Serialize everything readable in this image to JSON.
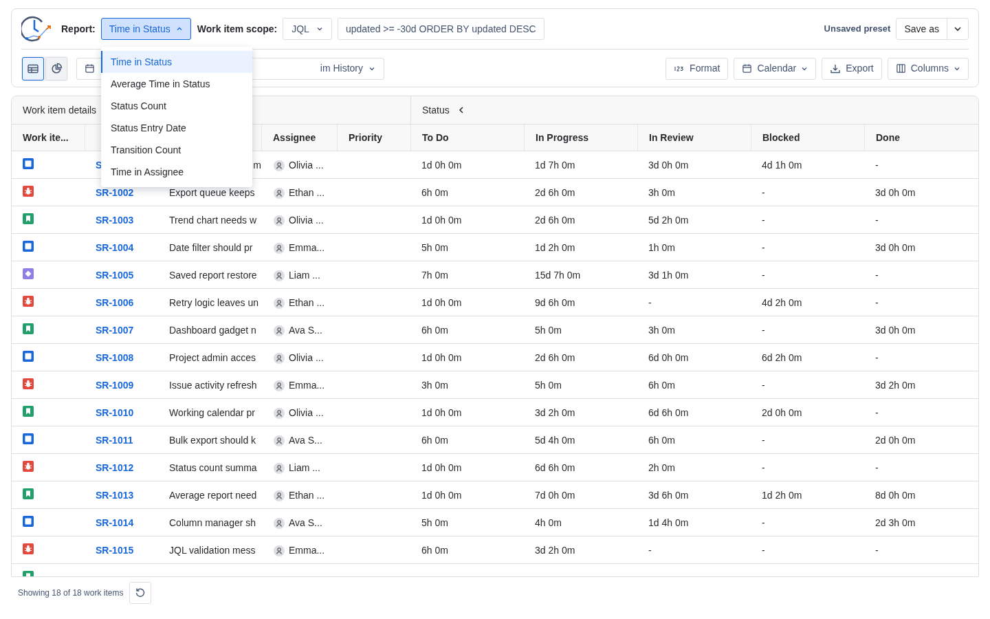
{
  "header": {
    "report_label": "Report:",
    "report_value": "Time in Status",
    "report_open": true,
    "scope_label": "Work item scope:",
    "scope_type": "JQL",
    "query": "updated >= -30d ORDER BY updated DESC",
    "preset": "Unsaved preset",
    "save_button": "Save as"
  },
  "view_toggle": [
    {
      "kind": "table",
      "selected": true
    },
    {
      "kind": "chart",
      "selected": false
    }
  ],
  "toolbar_left": [
    {
      "kind": "calendar"
    },
    {
      "kind": "history",
      "label": "im History"
    }
  ],
  "toolbar_right": [
    {
      "kind": "format",
      "label": "Format",
      "caret": false
    },
    {
      "kind": "calendar",
      "label": "Calendar",
      "caret": true
    },
    {
      "kind": "export",
      "label": "Export",
      "caret": false
    },
    {
      "kind": "columns",
      "label": "Columns",
      "caret": true
    }
  ],
  "report_menu": [
    {
      "label": "Time in Status",
      "selected": true
    },
    {
      "label": "Average Time in Status",
      "selected": false
    },
    {
      "label": "Status Count",
      "selected": false
    },
    {
      "label": "Status Entry Date",
      "selected": false
    },
    {
      "label": "Transition Count",
      "selected": false
    },
    {
      "label": "Time in Assignee",
      "selected": false
    }
  ],
  "table": {
    "groups": [
      {
        "label": "Work item details"
      },
      {
        "label": "Status"
      }
    ],
    "columns": [
      "Work ite...",
      "",
      "",
      "Assignee",
      "Priority",
      "To Do",
      "In Progress",
      "In Review",
      "Blocked",
      "Done"
    ],
    "rows": [
      {
        "kind": "task",
        "key": "S",
        "summary": "m",
        "assignee": "Olivia ...",
        "times": [
          "1d 0h 0m",
          "1d 7h 0m",
          "3d 0h 0m",
          "4d 1h 0m",
          "-"
        ]
      },
      {
        "kind": "bug",
        "key": "SR-1002",
        "summary": "Export queue keeps",
        "assignee": "Ethan ...",
        "times": [
          "6h 0m",
          "2d 6h 0m",
          "3h 0m",
          "-",
          "3d 0h 0m"
        ]
      },
      {
        "kind": "story",
        "key": "SR-1003",
        "summary": "Trend chart needs w",
        "assignee": "Olivia ...",
        "times": [
          "1d 0h 0m",
          "2d 6h 0m",
          "5d 2h 0m",
          "-",
          "-"
        ]
      },
      {
        "kind": "task",
        "key": "SR-1004",
        "summary": "Date filter should pr",
        "assignee": "Emma...",
        "times": [
          "5h 0m",
          "1d 2h 0m",
          "1h 0m",
          "-",
          "3d 0h 0m"
        ]
      },
      {
        "kind": "epic",
        "key": "SR-1005",
        "summary": "Saved report restore",
        "assignee": "Liam ...",
        "times": [
          "7h 0m",
          "15d 7h 0m",
          "3d 1h 0m",
          "-",
          "-"
        ]
      },
      {
        "kind": "bug",
        "key": "SR-1006",
        "summary": "Retry logic leaves un",
        "assignee": "Ethan ...",
        "times": [
          "1d 0h 0m",
          "9d 6h 0m",
          "-",
          "4d 2h 0m",
          "-"
        ]
      },
      {
        "kind": "story",
        "key": "SR-1007",
        "summary": "Dashboard gadget n",
        "assignee": "Ava S...",
        "times": [
          "6h 0m",
          "5h 0m",
          "3h 0m",
          "-",
          "3d 0h 0m"
        ]
      },
      {
        "kind": "task",
        "key": "SR-1008",
        "summary": "Project admin acces",
        "assignee": "Olivia ...",
        "times": [
          "1d 0h 0m",
          "2d 6h 0m",
          "6d 0h 0m",
          "6d 2h 0m",
          "-"
        ]
      },
      {
        "kind": "bug",
        "key": "SR-1009",
        "summary": "Issue activity refresh",
        "assignee": "Emma...",
        "times": [
          "3h 0m",
          "5h 0m",
          "6h 0m",
          "-",
          "3d 2h 0m"
        ]
      },
      {
        "kind": "story",
        "key": "SR-1010",
        "summary": "Working calendar pr",
        "assignee": "Olivia ...",
        "times": [
          "1d 0h 0m",
          "3d 2h 0m",
          "6d 6h 0m",
          "2d 0h 0m",
          "-"
        ]
      },
      {
        "kind": "task",
        "key": "SR-1011",
        "summary": "Bulk export should k",
        "assignee": "Ava S...",
        "times": [
          "6h 0m",
          "5d 4h 0m",
          "6h 0m",
          "-",
          "2d 0h 0m"
        ]
      },
      {
        "kind": "bug",
        "key": "SR-1012",
        "summary": "Status count summa",
        "assignee": "Liam ...",
        "times": [
          "1d 0h 0m",
          "6d 6h 0m",
          "2h 0m",
          "-",
          "-"
        ]
      },
      {
        "kind": "story",
        "key": "SR-1013",
        "summary": "Average report need",
        "assignee": "Ethan ...",
        "times": [
          "1d 0h 0m",
          "7d 0h 0m",
          "3d 6h 0m",
          "1d 2h 0m",
          "8d 0h 0m"
        ]
      },
      {
        "kind": "task",
        "key": "SR-1014",
        "summary": "Column manager sh",
        "assignee": "Ava S...",
        "times": [
          "5h 0m",
          "4h 0m",
          "1d 4h 0m",
          "-",
          "2d 3h 0m"
        ]
      },
      {
        "kind": "bug",
        "key": "SR-1015",
        "summary": "JQL validation mess",
        "assignee": "Emma...",
        "times": [
          "6h 0m",
          "3d 2h 0m",
          "-",
          "-",
          "-"
        ]
      },
      {
        "kind": "story"
      }
    ]
  },
  "footer": {
    "count": "Showing 18 of 18 work items"
  }
}
